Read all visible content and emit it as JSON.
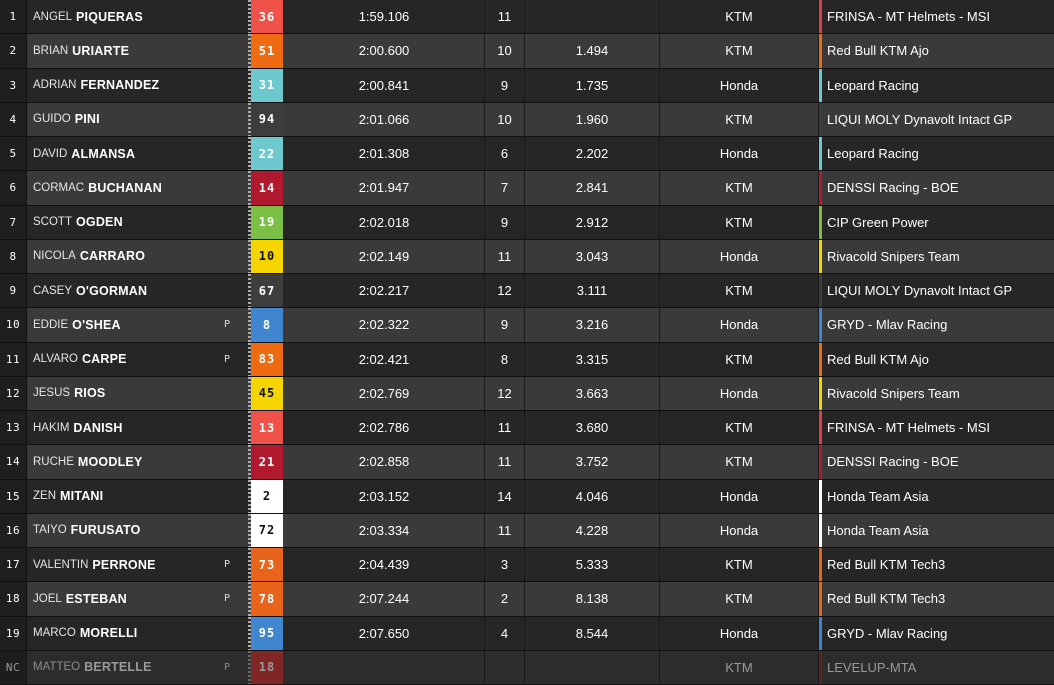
{
  "results": [
    {
      "pos": "1",
      "first": "ANGEL",
      "last": "PIQUERAS",
      "flag": "",
      "number": "36",
      "color": "#f0524a",
      "time": "1:59.106",
      "laps": "11",
      "gap": "",
      "bike": "KTM",
      "team": "FRINSA - MT Helmets - MSI",
      "team_color": "#e0404c",
      "text_dark": false
    },
    {
      "pos": "2",
      "first": "BRIAN",
      "last": "URIARTE",
      "flag": "",
      "number": "51",
      "color": "#ef6b12",
      "time": "2:00.600",
      "laps": "10",
      "gap": "1.494",
      "bike": "KTM",
      "team": "Red Bull KTM Ajo",
      "team_color": "#ef6b12",
      "text_dark": false
    },
    {
      "pos": "3",
      "first": "ADRIAN",
      "last": "FERNANDEZ",
      "flag": "",
      "number": "31",
      "color": "#6ec9cf",
      "time": "2:00.841",
      "laps": "9",
      "gap": "1.735",
      "bike": "Honda",
      "team": "Leopard Racing",
      "team_color": "#6ec9cf",
      "text_dark": false
    },
    {
      "pos": "4",
      "first": "GUIDO",
      "last": "PINI",
      "flag": "",
      "number": "94",
      "color": "#3d3d3d",
      "time": "2:01.066",
      "laps": "10",
      "gap": "1.960",
      "bike": "KTM",
      "team": "LIQUI MOLY Dynavolt Intact GP",
      "team_color": "#3d3d3d",
      "text_dark": false
    },
    {
      "pos": "5",
      "first": "DAVID",
      "last": "ALMANSA",
      "flag": "",
      "number": "22",
      "color": "#6ec9cf",
      "time": "2:01.308",
      "laps": "6",
      "gap": "2.202",
      "bike": "Honda",
      "team": "Leopard Racing",
      "team_color": "#6ec9cf",
      "text_dark": false
    },
    {
      "pos": "6",
      "first": "CORMAC",
      "last": "BUCHANAN",
      "flag": "",
      "number": "14",
      "color": "#b0192e",
      "time": "2:01.947",
      "laps": "7",
      "gap": "2.841",
      "bike": "KTM",
      "team": "DENSSI Racing - BOE",
      "team_color": "#b0192e",
      "text_dark": false
    },
    {
      "pos": "7",
      "first": "SCOTT",
      "last": "OGDEN",
      "flag": "",
      "number": "19",
      "color": "#7cbf45",
      "time": "2:02.018",
      "laps": "9",
      "gap": "2.912",
      "bike": "KTM",
      "team": "CIP Green Power",
      "team_color": "#7cbf45",
      "text_dark": false
    },
    {
      "pos": "8",
      "first": "NICOLA",
      "last": "CARRARO",
      "flag": "",
      "number": "10",
      "color": "#f6d400",
      "time": "2:02.149",
      "laps": "11",
      "gap": "3.043",
      "bike": "Honda",
      "team": "Rivacold Snipers Team",
      "team_color": "#f6d400",
      "text_dark": true
    },
    {
      "pos": "9",
      "first": "CASEY",
      "last": "O'GORMAN",
      "flag": "",
      "number": "67",
      "color": "#3d3d3d",
      "time": "2:02.217",
      "laps": "12",
      "gap": "3.111",
      "bike": "KTM",
      "team": "LIQUI MOLY Dynavolt Intact GP",
      "team_color": "#3d3d3d",
      "text_dark": false
    },
    {
      "pos": "10",
      "first": "EDDIE",
      "last": "O'SHEA",
      "flag": "P",
      "number": "8",
      "color": "#3f86cf",
      "time": "2:02.322",
      "laps": "9",
      "gap": "3.216",
      "bike": "Honda",
      "team": "GRYD - Mlav Racing",
      "team_color": "#3f86cf",
      "text_dark": false
    },
    {
      "pos": "11",
      "first": "ALVARO",
      "last": "CARPE",
      "flag": "P",
      "number": "83",
      "color": "#ef6b12",
      "time": "2:02.421",
      "laps": "8",
      "gap": "3.315",
      "bike": "KTM",
      "team": "Red Bull KTM Ajo",
      "team_color": "#ef6b12",
      "text_dark": false
    },
    {
      "pos": "12",
      "first": "JESUS",
      "last": "RIOS",
      "flag": "",
      "number": "45",
      "color": "#f6d400",
      "time": "2:02.769",
      "laps": "12",
      "gap": "3.663",
      "bike": "Honda",
      "team": "Rivacold Snipers Team",
      "team_color": "#f6d400",
      "text_dark": true
    },
    {
      "pos": "13",
      "first": "HAKIM",
      "last": "DANISH",
      "flag": "",
      "number": "13",
      "color": "#f0524a",
      "time": "2:02.786",
      "laps": "11",
      "gap": "3.680",
      "bike": "KTM",
      "team": "FRINSA - MT Helmets - MSI",
      "team_color": "#e0404c",
      "text_dark": false
    },
    {
      "pos": "14",
      "first": "RUCHE",
      "last": "MOODLEY",
      "flag": "",
      "number": "21",
      "color": "#b0192e",
      "time": "2:02.858",
      "laps": "11",
      "gap": "3.752",
      "bike": "KTM",
      "team": "DENSSI Racing - BOE",
      "team_color": "#b0192e",
      "text_dark": false
    },
    {
      "pos": "15",
      "first": "ZEN",
      "last": "MITANI",
      "flag": "",
      "number": "2",
      "color": "#ffffff",
      "time": "2:03.152",
      "laps": "14",
      "gap": "4.046",
      "bike": "Honda",
      "team": "Honda Team Asia",
      "team_color": "#ffffff",
      "text_dark": true
    },
    {
      "pos": "16",
      "first": "TAIYO",
      "last": "FURUSATO",
      "flag": "",
      "number": "72",
      "color": "#ffffff",
      "time": "2:03.334",
      "laps": "11",
      "gap": "4.228",
      "bike": "Honda",
      "team": "Honda Team Asia",
      "team_color": "#ffffff",
      "text_dark": true
    },
    {
      "pos": "17",
      "first": "VALENTIN",
      "last": "PERRONE",
      "flag": "P",
      "number": "73",
      "color": "#e7641a",
      "time": "2:04.439",
      "laps": "3",
      "gap": "5.333",
      "bike": "KTM",
      "team": "Red Bull KTM Tech3",
      "team_color": "#e7641a",
      "text_dark": false
    },
    {
      "pos": "18",
      "first": "JOEL",
      "last": "ESTEBAN",
      "flag": "P",
      "number": "78",
      "color": "#e7641a",
      "time": "2:07.244",
      "laps": "2",
      "gap": "8.138",
      "bike": "KTM",
      "team": "Red Bull KTM Tech3",
      "team_color": "#e7641a",
      "text_dark": false
    },
    {
      "pos": "19",
      "first": "MARCO",
      "last": "MORELLI",
      "flag": "",
      "number": "95",
      "color": "#3f86cf",
      "time": "2:07.650",
      "laps": "4",
      "gap": "8.544",
      "bike": "Honda",
      "team": "GRYD - Mlav Racing",
      "team_color": "#3f86cf",
      "text_dark": false
    },
    {
      "pos": "NC",
      "first": "MATTEO",
      "last": "BERTELLE",
      "flag": "P",
      "number": "18",
      "color": "#d4312e",
      "time": "",
      "laps": "",
      "gap": "",
      "bike": "KTM",
      "team": "LEVELUP-MTA",
      "team_color": "#8a2a2a",
      "text_dark": false
    }
  ]
}
